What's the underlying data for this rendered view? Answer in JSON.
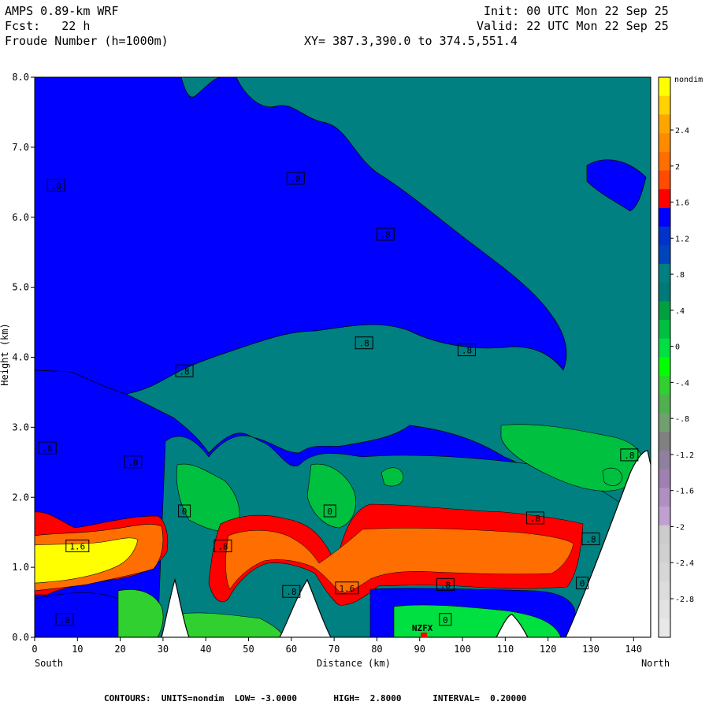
{
  "header": {
    "model": "AMPS 0.89-km WRF",
    "fcst": "Fcst:   22 h",
    "field": "Froude Number (h=1000m)",
    "init": "Init: 00 UTC Mon 22 Sep 25",
    "valid": "Valid: 22 UTC Mon 22 Sep 25",
    "xy": "XY= 387.3,390.0 to 374.5,551.4"
  },
  "footer": {
    "contours": "CONTOURS:  UNITS=nondim  LOW= -3.0000       HIGH=  2.8000      INTERVAL=  0.20000"
  },
  "chart_data": {
    "type": "heatmap",
    "title": "Froude Number (h=1000m)",
    "xlabel": "Distance (km)",
    "ylabel": "Height (km)",
    "xlim": [
      0,
      144
    ],
    "ylim": [
      0,
      8
    ],
    "x_ticks": [
      0,
      10,
      20,
      30,
      40,
      50,
      60,
      70,
      80,
      90,
      100,
      110,
      120,
      130,
      140
    ],
    "y_ticks": [
      "0.0",
      "1.0",
      "2.0",
      "3.0",
      "4.0",
      "5.0",
      "6.0",
      "7.0",
      "8.0"
    ],
    "x_end_labels": {
      "left": "South",
      "right": "North"
    },
    "station_label": {
      "text": "NZFX",
      "x": 91
    },
    "colorbar": {
      "unit": "nondim",
      "labels": [
        "2.4",
        "2",
        "1.6",
        "1.2",
        ".8",
        ".4",
        "0",
        "-.4",
        "-.8",
        "-1.2",
        "-1.6",
        "-2",
        "-2.4",
        "-2.8"
      ],
      "colors": [
        "#ffff00",
        "#ffd200",
        "#ffa500",
        "#ff8c00",
        "#ff6e00",
        "#ff4a00",
        "#ff0000",
        "#0000ff",
        "#0033cc",
        "#0044bb",
        "#008080",
        "#007a78",
        "#00a040",
        "#00c040",
        "#00e040",
        "#00ff00",
        "#30d030",
        "#50b050",
        "#70a070",
        "#808080",
        "#9080a0",
        "#a080b0",
        "#b090c0",
        "#c0a0d0",
        "#cccccc",
        "#d0d0d0",
        "#d6d6d6",
        "#dcdcdc",
        "#e2e2e2",
        "#e8e8e8"
      ]
    },
    "contour_labels": [
      {
        "text": ".8",
        "x": 5,
        "y": 6.45
      },
      {
        "text": ".8",
        "x": 61,
        "y": 6.55
      },
      {
        "text": ".8",
        "x": 82,
        "y": 5.75
      },
      {
        "text": ".8",
        "x": 35,
        "y": 3.8
      },
      {
        "text": ".8",
        "x": 77,
        "y": 4.2
      },
      {
        "text": ".8",
        "x": 101,
        "y": 4.1
      },
      {
        "text": ".8",
        "x": 3,
        "y": 2.7
      },
      {
        "text": ".8",
        "x": 23,
        "y": 2.5
      },
      {
        "text": "0",
        "x": 35,
        "y": 1.8
      },
      {
        "text": "0",
        "x": 69,
        "y": 1.8
      },
      {
        "text": ".8",
        "x": 117,
        "y": 1.7
      },
      {
        "text": "1.6",
        "x": 10,
        "y": 1.3
      },
      {
        "text": ".8",
        "x": 44,
        "y": 1.3
      },
      {
        "text": ".8",
        "x": 130,
        "y": 1.4
      },
      {
        "text": ".8",
        "x": 139,
        "y": 2.6
      },
      {
        "text": "1.6",
        "x": 73,
        "y": 0.7
      },
      {
        "text": ".8",
        "x": 60,
        "y": 0.65
      },
      {
        "text": ".8",
        "x": 96,
        "y": 0.75
      },
      {
        "text": "0",
        "x": 128,
        "y": 0.77
      },
      {
        "text": "0",
        "x": 96,
        "y": 0.25
      },
      {
        "text": ".8",
        "x": 7,
        "y": 0.25
      }
    ]
  }
}
